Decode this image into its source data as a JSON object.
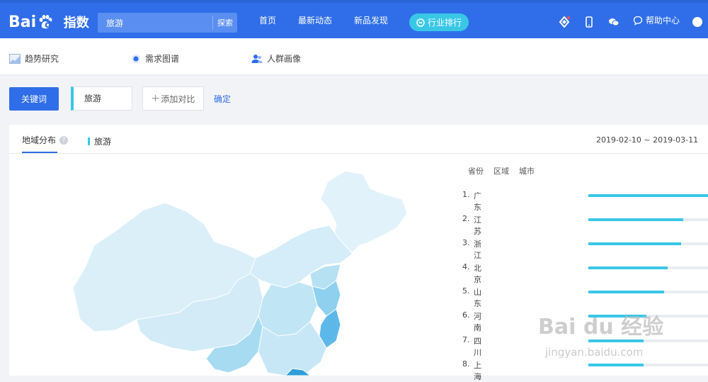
{
  "header": {
    "logo_text": "Bai",
    "logo_text2": "du",
    "logo_sub": "指数",
    "search_value": "旅游",
    "search_button": "探索",
    "nav": [
      "首页",
      "最新动态",
      "新品发现"
    ],
    "rank_button": "行业排行",
    "help": "帮助中心"
  },
  "subnav": {
    "items": [
      "趋势研究",
      "需求图谱",
      "人群画像"
    ]
  },
  "toolbar": {
    "keyword_button": "关键词",
    "keyword_value": "旅游",
    "add_compare": "添加对比",
    "confirm": "确定"
  },
  "panel": {
    "tab_label": "地域分布",
    "help_mark": "?",
    "legend_label": "旅游",
    "date_range": "2019-02-10 ~ 2019-03-11",
    "rank_tabs": [
      "省份",
      "区域",
      "城市"
    ],
    "rankings": [
      {
        "num": "1.",
        "name": "广东",
        "share": 1.0
      },
      {
        "num": "2.",
        "name": "江苏",
        "share": 0.79
      },
      {
        "num": "3.",
        "name": "浙江",
        "share": 0.77
      },
      {
        "num": "4.",
        "name": "北京",
        "share": 0.66
      },
      {
        "num": "5.",
        "name": "山东",
        "share": 0.63
      },
      {
        "num": "6.",
        "name": "河南",
        "share": 0.48
      },
      {
        "num": "7.",
        "name": "四川",
        "share": 0.46
      },
      {
        "num": "8.",
        "name": "上海",
        "share": 0.46
      }
    ]
  },
  "colors": {
    "header_bg": "#2f6ee8",
    "accent": "#39c7e6",
    "map_light": "#dbeff9",
    "map_mid": "#b6e1f3",
    "map_dark": "#5db8e9"
  },
  "watermark": {
    "text": "Bai du 经验",
    "url": "jingyan.baidu.com"
  }
}
